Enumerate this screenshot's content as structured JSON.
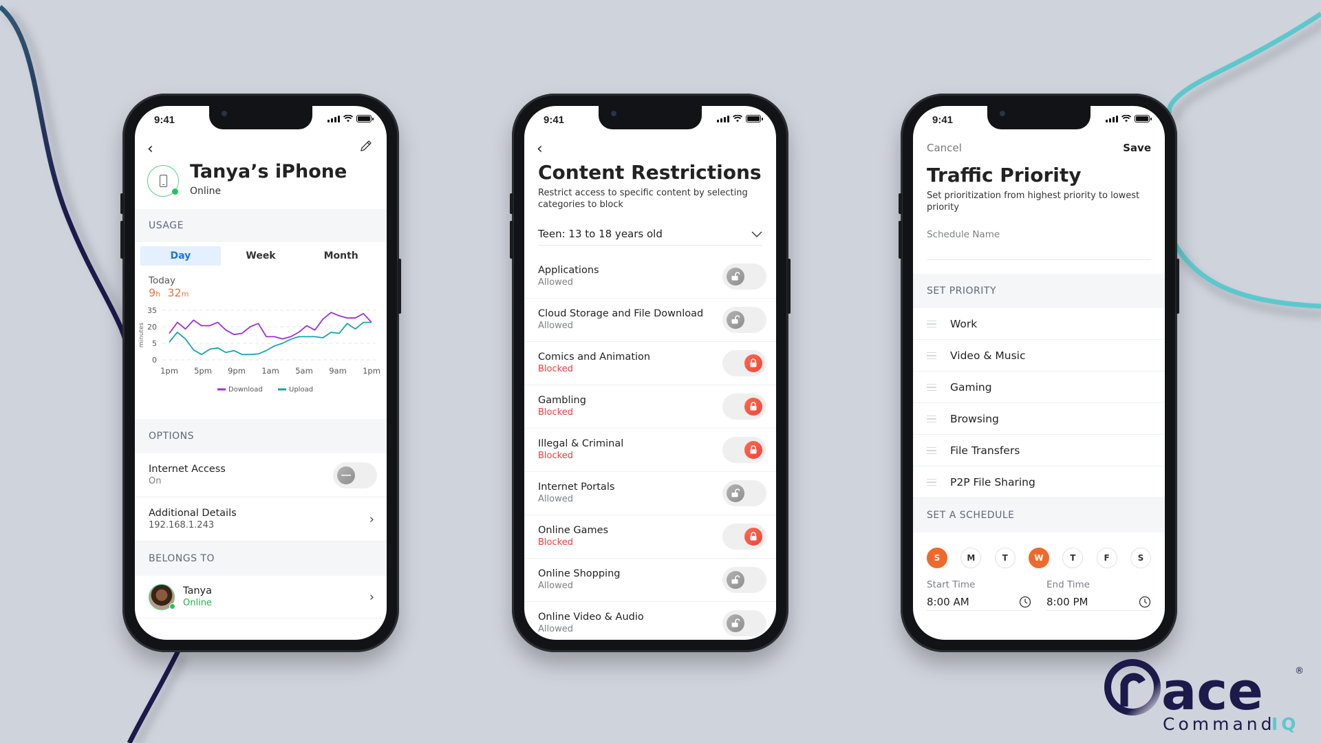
{
  "brand": {
    "logo_text": "ace",
    "logo_sub_1": "Command",
    "logo_sub_2": "IQ",
    "registered": "®",
    "colors": {
      "navy": "#1c1a4a",
      "teal": "#5cc8cc",
      "accent_orange": "#ee6a2c",
      "blocked_red": "#ef3b3b",
      "online_green": "#22c55e",
      "link_blue": "#1a73e8"
    }
  },
  "status_bar": {
    "time": "9:41"
  },
  "device_screen": {
    "back_icon": "chevron-left-icon",
    "edit_icon": "pencil-icon",
    "title": "Tanya’s iPhone",
    "status": "Online",
    "usage_header": "USAGE",
    "tabs": [
      {
        "label": "Day",
        "active": true
      },
      {
        "label": "Week",
        "active": false
      },
      {
        "label": "Month",
        "active": false
      }
    ],
    "today_label": "Today",
    "duration": {
      "hours": "9",
      "h_unit": "h",
      "minutes": "32",
      "m_unit": "m"
    },
    "options_header": "OPTIONS",
    "internet_access": {
      "label": "Internet Access",
      "value": "On"
    },
    "additional_details": {
      "label": "Additional Details",
      "value": "192.168.1.243"
    },
    "belongs_header": "BELONGS TO",
    "owner": {
      "name": "Tanya",
      "status": "Online"
    }
  },
  "chart_data": {
    "type": "line",
    "title": "",
    "xlabel": "",
    "ylabel": "minutes",
    "y_ticks": [
      0,
      5,
      20,
      35
    ],
    "y_scale": "piecewise (ticks evenly spaced)",
    "x_ticks": [
      "1pm",
      "5pm",
      "9pm",
      "1am",
      "5am",
      "9am",
      "1pm"
    ],
    "grid": true,
    "legend_position": "bottom",
    "series": [
      {
        "name": "Download",
        "color": "#9b2fd6",
        "values": [
          14,
          24,
          18,
          26,
          21,
          21,
          24,
          17,
          13,
          14,
          20,
          23,
          11,
          11,
          9,
          11,
          15,
          21,
          17,
          27,
          33,
          30,
          28,
          28,
          32,
          24
        ]
      },
      {
        "name": "Upload",
        "color": "#13a5ad",
        "values": [
          6,
          15,
          9,
          3,
          1.6,
          3.2,
          3.6,
          2.2,
          2.8,
          1.6,
          1.6,
          1.8,
          2.8,
          4.2,
          5,
          8.6,
          11,
          11,
          11,
          10,
          15,
          14,
          23,
          18,
          24,
          24
        ]
      }
    ]
  },
  "content_screen": {
    "title": "Content Restrictions",
    "description": "Restrict access to specific content by selecting categories to block",
    "age_select": "Teen: 13 to 18 years old",
    "categories": [
      {
        "label": "Applications",
        "status": "Allowed",
        "blocked": false
      },
      {
        "label": "Cloud Storage and File Download",
        "status": "Allowed",
        "blocked": false
      },
      {
        "label": "Comics and Animation",
        "status": "Blocked",
        "blocked": true
      },
      {
        "label": "Gambling",
        "status": "Blocked",
        "blocked": true
      },
      {
        "label": "Illegal & Criminal",
        "status": "Blocked",
        "blocked": true
      },
      {
        "label": "Internet Portals",
        "status": "Allowed",
        "blocked": false
      },
      {
        "label": "Online Games",
        "status": "Blocked",
        "blocked": true
      },
      {
        "label": "Online Shopping",
        "status": "Allowed",
        "blocked": false
      },
      {
        "label": "Online Video & Audio",
        "status": "Allowed",
        "blocked": false
      }
    ]
  },
  "priority_screen": {
    "cancel": "Cancel",
    "save": "Save",
    "title": "Traffic Priority",
    "description": "Set prioritization from highest priority to lowest priority",
    "schedule_name_label": "Schedule Name",
    "schedule_name_value": "",
    "set_priority_header": "SET PRIORITY",
    "priorities": [
      "Work",
      "Video & Music",
      "Gaming",
      "Browsing",
      "File Transfers",
      "P2P File Sharing"
    ],
    "set_schedule_header": "SET A SCHEDULE",
    "days": [
      {
        "label": "S",
        "selected": true
      },
      {
        "label": "M",
        "selected": false
      },
      {
        "label": "T",
        "selected": false
      },
      {
        "label": "W",
        "selected": true
      },
      {
        "label": "T",
        "selected": false
      },
      {
        "label": "F",
        "selected": false
      },
      {
        "label": "S",
        "selected": false
      }
    ],
    "start_time": {
      "label": "Start Time",
      "value": "8:00 AM"
    },
    "end_time": {
      "label": "End Time",
      "value": "8:00 PM"
    }
  }
}
